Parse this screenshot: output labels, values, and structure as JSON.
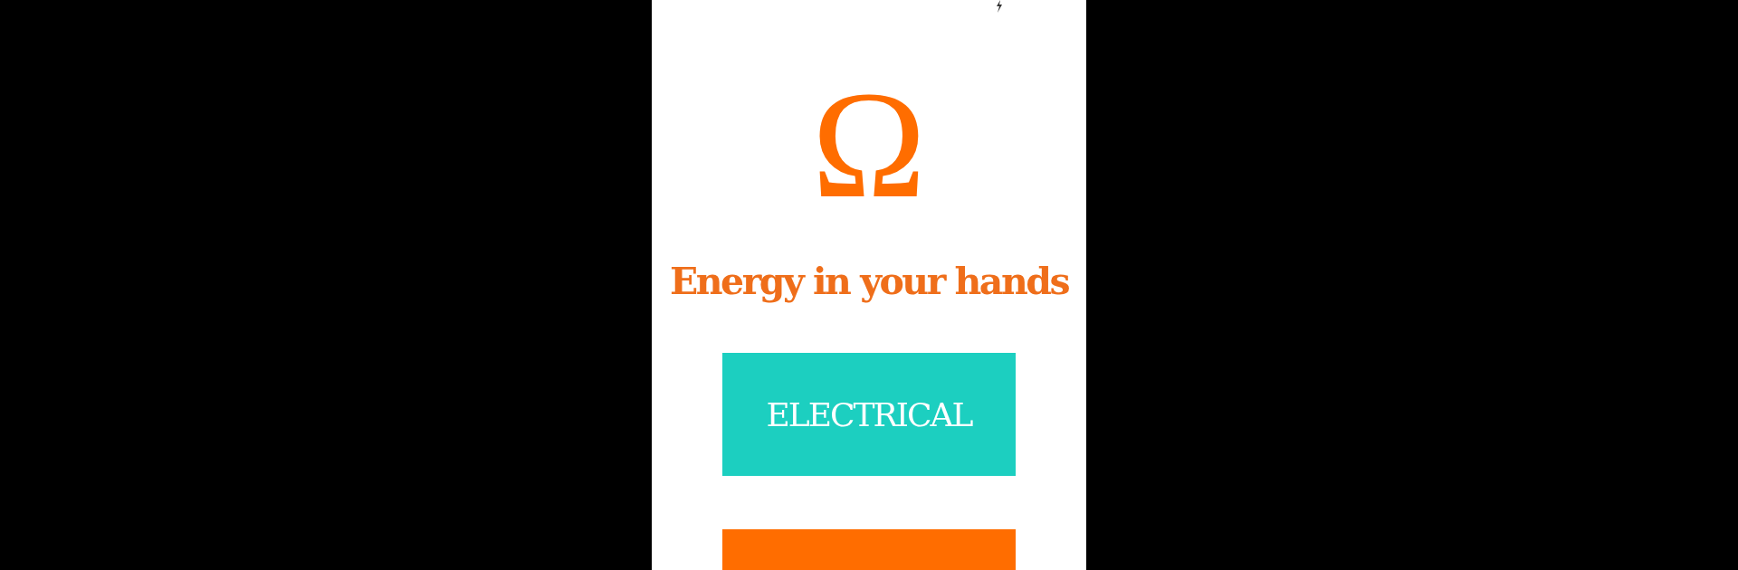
{
  "logo": {
    "symbol": "Ω"
  },
  "tagline": "Energy in your hands",
  "buttons": [
    {
      "label": "ELECTRICAL",
      "color": "#1ccfc0"
    },
    {
      "color": "#ff6d00"
    }
  ]
}
